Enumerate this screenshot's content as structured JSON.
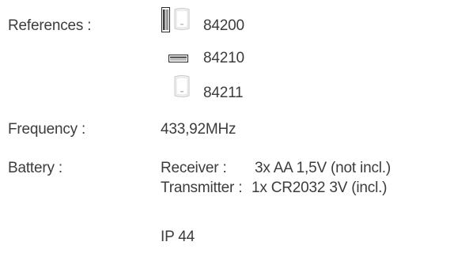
{
  "specs": {
    "references": {
      "label": "References :",
      "items": [
        {
          "icons": [
            "tall-transmitter-icon",
            "receiver-icon"
          ],
          "code": "84200"
        },
        {
          "icons": [
            "flat-transmitter-icon"
          ],
          "code": "84210"
        },
        {
          "icons": [
            "receiver-icon"
          ],
          "code": "84211"
        }
      ]
    },
    "frequency": {
      "label": "Frequency :",
      "value": "433,92MHz"
    },
    "battery": {
      "label": "Battery :",
      "receiver_label": "Receiver :",
      "receiver_value": "3x AA 1,5V  (not incl.)",
      "transmitter_label": "Transmitter :",
      "transmitter_value": "1x CR2032 3V (incl.)"
    },
    "protection": "IP 44"
  }
}
